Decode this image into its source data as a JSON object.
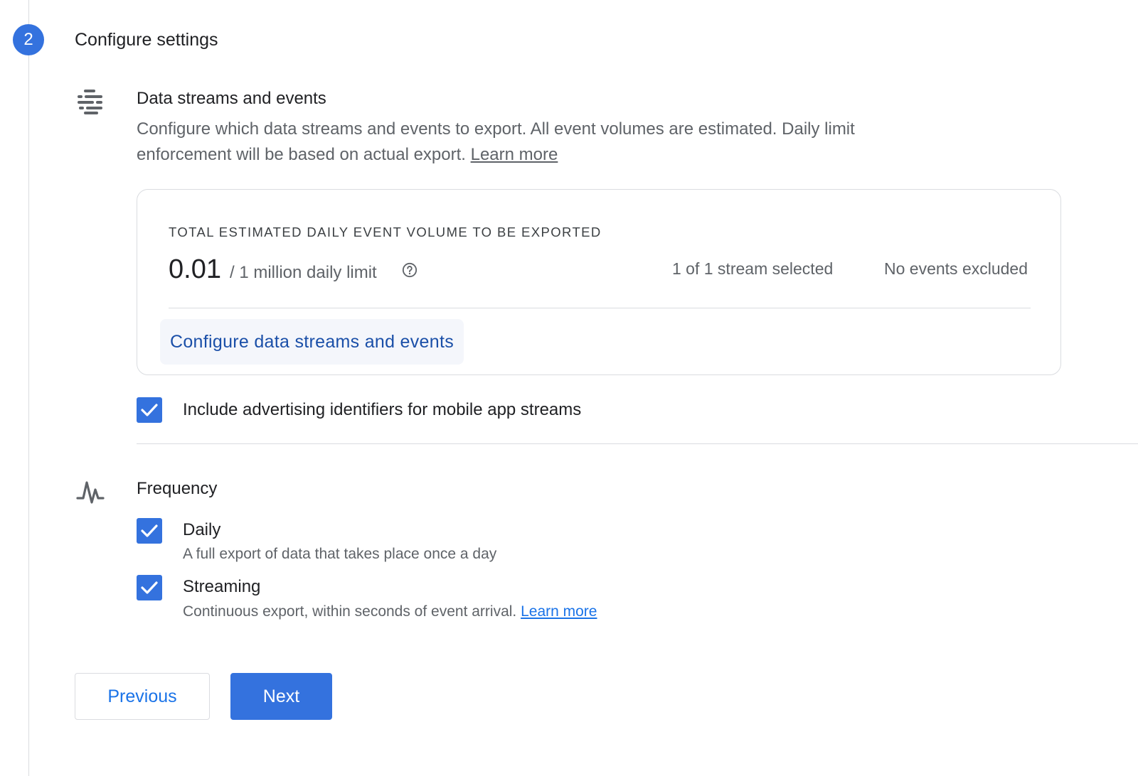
{
  "step": {
    "number": "2",
    "title": "Configure settings"
  },
  "data_streams": {
    "title": "Data streams and events",
    "description": "Configure which data streams and events to export. All event volumes are estimated. Daily limit enforcement will be based on actual export.",
    "learn_more": "Learn more",
    "icon": "tune-sliders-icon",
    "card": {
      "label": "TOTAL ESTIMATED DAILY EVENT VOLUME TO BE EXPORTED",
      "value": "0.01",
      "limit": "/ 1 million daily limit",
      "streams": "1 of 1 stream selected",
      "events": "No events excluded",
      "configure_button": "Configure data streams and events"
    },
    "ad_ids": {
      "label": "Include advertising identifiers for mobile app streams",
      "checked": true
    }
  },
  "frequency": {
    "title": "Frequency",
    "icon": "pulse-icon",
    "daily": {
      "label": "Daily",
      "description": "A full export of data that takes place once a day",
      "checked": true
    },
    "streaming": {
      "label": "Streaming",
      "description": "Continuous export, within seconds of event arrival.",
      "learn_more": "Learn more",
      "checked": true
    }
  },
  "buttons": {
    "previous": "Previous",
    "next": "Next"
  },
  "colors": {
    "primary": "#3472de",
    "link": "#1a73e8",
    "text": "#202124",
    "muted": "#5f6368",
    "border": "#dadce0"
  }
}
